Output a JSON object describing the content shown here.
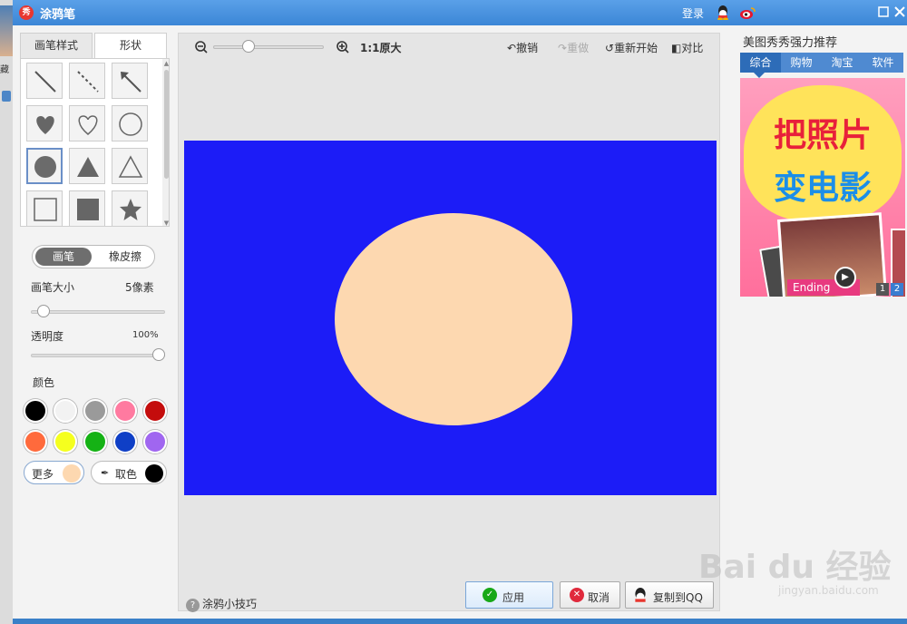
{
  "window": {
    "title": "涂鸦笔",
    "login": "登录",
    "app_icon_text": "秀"
  },
  "desktop": {
    "side_label": "藏"
  },
  "left": {
    "tabs": [
      "画笔样式",
      "形状"
    ],
    "modes": [
      "画笔",
      "橡皮擦"
    ],
    "brush_size_label": "画笔大小",
    "brush_size_value": "5像素",
    "brush_size_level": 0.05,
    "opacity_label": "透明度",
    "opacity_value": "100%",
    "opacity_level": 1.0,
    "color_label": "颜色",
    "colors": [
      "#000000",
      "#f2f2f2",
      "#9a9a9a",
      "#ff7aa0",
      "#c40c0c",
      "#ff6a3c",
      "#f5ff1e",
      "#15b215",
      "#0f3fc6",
      "#a066f0"
    ],
    "more_label": "更多",
    "more_color": "#fdd8b0",
    "pick_label": "取色",
    "pick_color": "#000000"
  },
  "toolbar": {
    "zoom_label": "1:1原大",
    "zoom_level": 0.3,
    "undo": "撤销",
    "redo": "重做",
    "restart": "重新开始",
    "compare": "对比"
  },
  "canvas": {
    "background": "#1c1cf7",
    "ellipse_color": "#fdd8b0"
  },
  "bottom": {
    "tips": "涂鸦小技巧",
    "apply": "应用",
    "cancel": "取消",
    "copy_qq": "复制到QQ"
  },
  "right": {
    "title": "美图秀秀强力推荐",
    "tabs": [
      "综合",
      "购物",
      "淘宝",
      "软件"
    ],
    "ad_line1": "把照片",
    "ad_line2": "变电影",
    "ad_ending": "Ending",
    "ad_pages": [
      "1",
      "2"
    ]
  },
  "watermark": {
    "text": "Bai du 经验",
    "url": "jingyan.baidu.com"
  }
}
